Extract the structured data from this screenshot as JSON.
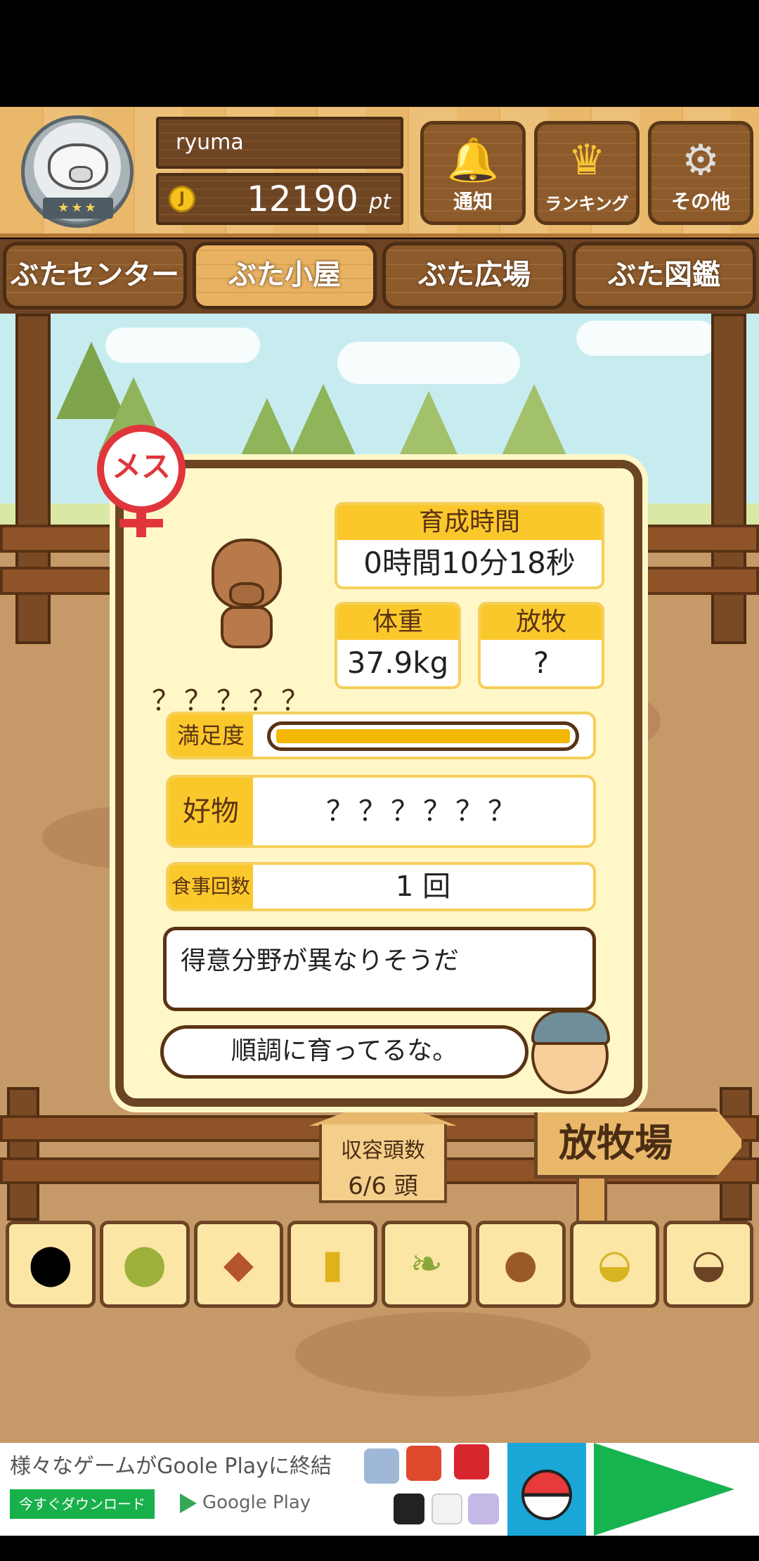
{
  "header": {
    "username": "ryuma",
    "points_value": "12190",
    "points_unit": "pt",
    "buttons": [
      {
        "label": "通知",
        "icon": "bell-icon"
      },
      {
        "label": "ランキング",
        "icon": "crown-icon"
      },
      {
        "label": "その他",
        "icon": "gear-icon"
      }
    ]
  },
  "tabs": [
    "ぶたセンター",
    "ぶた小屋",
    "ぶた広場",
    "ぶた図鑑"
  ],
  "active_tab": "ぶた小屋",
  "dialog": {
    "gender_label": "メス",
    "pig_name": "？？？？？",
    "growth_time_label": "育成時間",
    "growth_time_value": "0時間10分18秒",
    "weight_label": "体重",
    "weight_value": "37.9kg",
    "grazing_label": "放牧",
    "grazing_value": "?",
    "satisfaction_label": "満足度",
    "satisfaction_level": 1.0,
    "favorite_label": "好物",
    "favorite_value": "？？？？？？",
    "meals_label": "食事回数",
    "meals_value": "1 回",
    "speech_1": "得意分野が異なりそうだ",
    "speech_2": "順調に育ってるな。"
  },
  "capacity": {
    "label": "収容頭数",
    "value": "6/6 頭"
  },
  "sign_label": "放牧場",
  "feed_items": [
    {
      "icon": "grain-pile-icon"
    },
    {
      "icon": "mixed-grain-icon"
    },
    {
      "icon": "sweet-potato-icon"
    },
    {
      "icon": "corn-icon"
    },
    {
      "icon": "soybean-icon"
    },
    {
      "icon": "acorn-icon"
    },
    {
      "icon": "grain-plate-icon"
    },
    {
      "icon": "chestnut-plate-icon"
    }
  ],
  "ad": {
    "text": "様々なゲームがGoole Playに終結",
    "cta": "今すぐダウンロード",
    "store": "Google Play"
  },
  "colors": {
    "accent": "#fbc82c",
    "wood": "#6b4424",
    "panel": "#fff7c8",
    "female": "#e1353c"
  }
}
